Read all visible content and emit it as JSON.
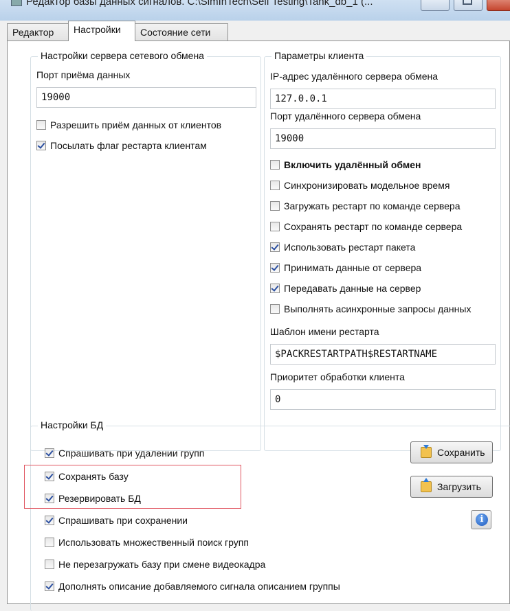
{
  "window": {
    "title": "Редактор базы данных сигналов. C:\\SimInTech\\Self Testing\\Tank_db_1 (..."
  },
  "tabs": [
    {
      "label": "Редактор"
    },
    {
      "label": "Настройки"
    },
    {
      "label": "Состояние сети"
    }
  ],
  "server": {
    "legend": "Настройки сервера сетевого обмена",
    "port_label": "Порт приёма данных",
    "port_value": "19000",
    "checkboxes": [
      {
        "label": "Разрешить приём данных от клиентов",
        "checked": false
      },
      {
        "label": "Посылать флаг рестарта клиентам",
        "checked": true
      }
    ]
  },
  "client": {
    "legend": "Параметры клиента",
    "ip_label": "IP-адрес удалённого сервера обмена",
    "ip_value": "127.0.0.1",
    "port_label": "Порт удалённого сервера обмена",
    "port_value": "19000",
    "checkboxes": [
      {
        "label": "Включить удалённый обмен",
        "checked": false
      },
      {
        "label": "Синхронизировать модельное время",
        "checked": false
      },
      {
        "label": "Загружать рестарт по команде сервера",
        "checked": false
      },
      {
        "label": "Сохранять рестарт по команде сервера",
        "checked": false
      },
      {
        "label": "Использовать рестарт пакета",
        "checked": true
      },
      {
        "label": "Принимать данные от сервера",
        "checked": true
      },
      {
        "label": "Передавать данные на сервер",
        "checked": true
      },
      {
        "label": "Выполнять асинхронные запросы данных",
        "checked": false
      }
    ],
    "template_label": "Шаблон имени рестарта",
    "template_value": "$PACKRESTARTPATH$RESTARTNAME",
    "priority_label": "Приоритет обработки клиента",
    "priority_value": "0"
  },
  "db": {
    "legend": "Настройки БД",
    "checkboxes": [
      {
        "label": "Спрашивать при удалении групп",
        "checked": true
      },
      {
        "label": "Сохранять базу",
        "checked": true
      },
      {
        "label": "Резервировать БД",
        "checked": true
      },
      {
        "label": "Спрашивать при сохранении",
        "checked": true
      },
      {
        "label": "Использовать множественный поиск групп",
        "checked": false
      },
      {
        "label": "Не перезагружать базу при смене видеокадра",
        "checked": false
      },
      {
        "label": "Дополнять описание добавляемого сигнала описанием группы",
        "checked": true
      }
    ],
    "save_button": "Сохранить",
    "load_button": "Загрузить"
  },
  "icons": {
    "app": "app-icon",
    "save": "save-icon",
    "load": "load-icon",
    "info": "info-icon",
    "minimize": "minimize-icon",
    "maximize": "maximize-icon",
    "close": "close-icon"
  },
  "colors": {
    "highlight": "#e0525e",
    "check": "#2b4fa0"
  }
}
